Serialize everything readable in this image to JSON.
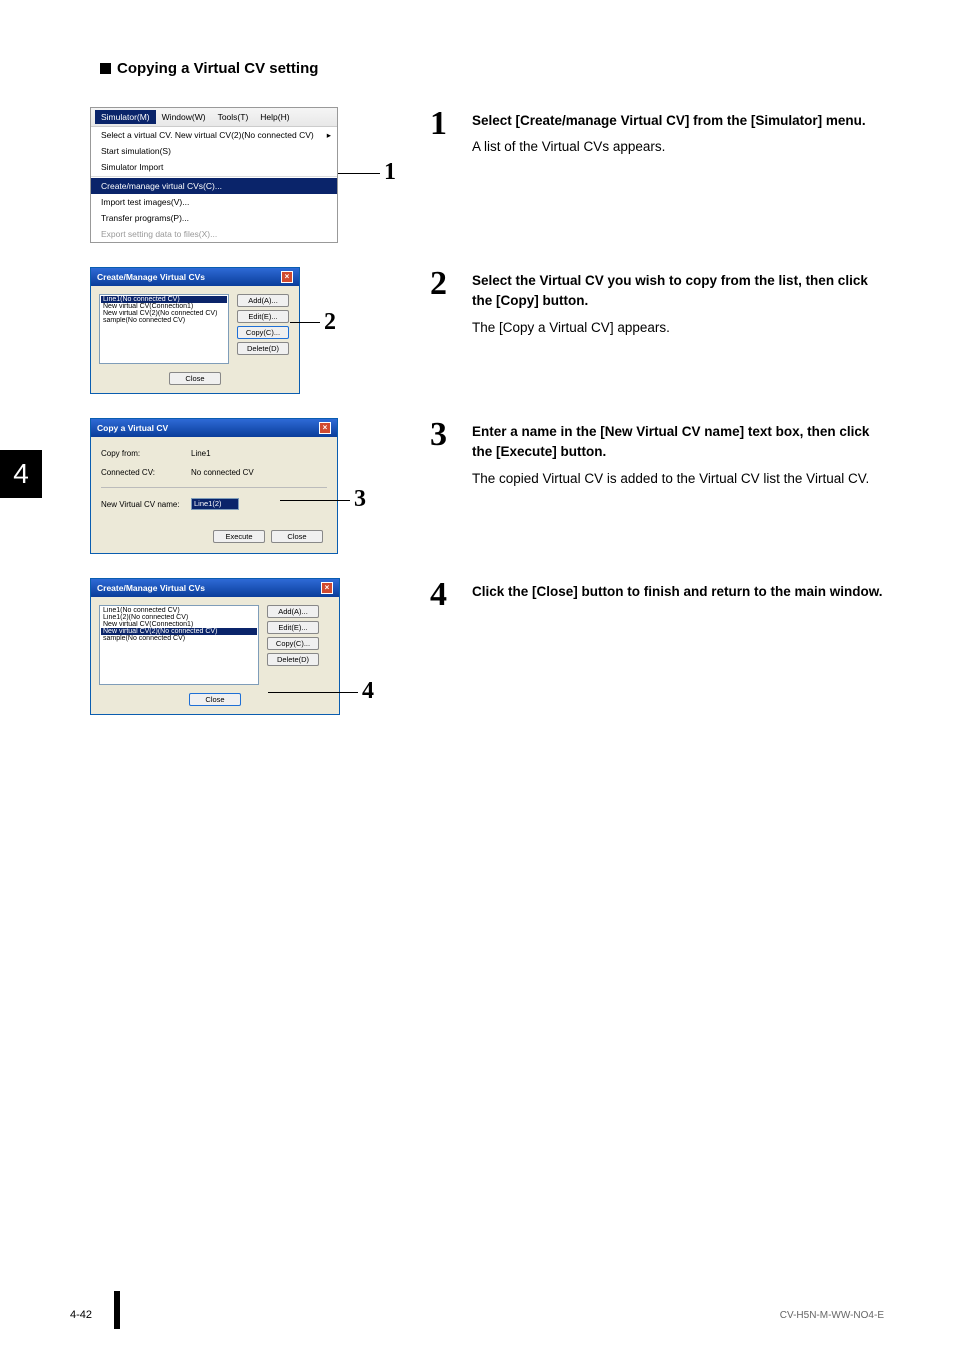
{
  "heading": "Copying a Virtual CV setting",
  "side_tab": "4",
  "steps": [
    {
      "num": "1",
      "bold": "Select [Create/manage Virtual CV] from the [Simulator] menu.",
      "desc": "A list of the Virtual CVs appears."
    },
    {
      "num": "2",
      "bold": "Select the Virtual CV you wish to copy from the list, then click the [Copy] button.",
      "desc": "The [Copy a Virtual CV] appears."
    },
    {
      "num": "3",
      "bold": "Enter a name in the [New Virtual CV name] text box, then click the [Execute] button.",
      "desc": "The copied Virtual CV is added to the Virtual CV list the Virtual CV."
    },
    {
      "num": "4",
      "bold": "Click the [Close] button to finish and return to the main window.",
      "desc": ""
    }
  ],
  "callouts": {
    "c1": "1",
    "c2": "2",
    "c3": "3",
    "c4": "4"
  },
  "menu": {
    "bar": {
      "simulator": "Simulator(M)",
      "window": "Window(W)",
      "tools": "Tools(T)",
      "help": "Help(H)"
    },
    "items": {
      "select": "Select a virtual CV.  New virtual CV(2)(No connected CV)",
      "start": "Start simulation(S)",
      "import_sim": "Simulator Import",
      "create": "Create/manage virtual CVs(C)...",
      "import_img": "Import test images(V)...",
      "transfer": "Transfer programs(P)...",
      "export": "Export setting data to files(X)..."
    },
    "arrow": "▸"
  },
  "manage_dlg": {
    "title": "Create/Manage Virtual CVs",
    "list2": [
      "Line1(No connected CV)",
      "New virtual CV(Connection1)",
      "New virtual CV(2)(No connected CV)",
      "sample(No connected CV)"
    ],
    "list4": [
      "Line1(No connected CV)",
      "Line1(2)(No connected CV)",
      "New virtual CV(Connection1)",
      "New virtual CV(2)(No connected CV)",
      "sample(No connected CV)"
    ],
    "buttons": {
      "add": "Add(A)...",
      "edit": "Edit(E)...",
      "copy": "Copy(C)...",
      "delete": "Delete(D)",
      "close": "Close"
    }
  },
  "copy_dlg": {
    "title": "Copy a Virtual CV",
    "copy_from_label": "Copy from:",
    "copy_from_val": "Line1",
    "connected_label": "Connected CV:",
    "connected_val": "No connected CV",
    "newname_label": "New Virtual CV name:",
    "newname_val": "Line1(2)",
    "execute": "Execute",
    "close": "Close"
  },
  "close_x": "×",
  "footer": {
    "page": "4-42",
    "doc": "CV-H5N-M-WW-NO4-E"
  }
}
